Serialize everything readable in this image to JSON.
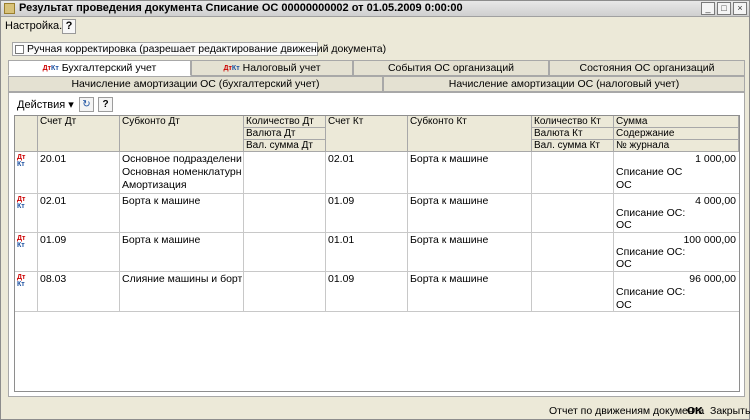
{
  "window": {
    "title": "Результат проведения документа Списание ОС 00000000002 от 01.05.2009 0:00:00",
    "min": "_",
    "max": "□",
    "close": "×"
  },
  "menu": {
    "settings": "Настройка...",
    "help": "?"
  },
  "manual": {
    "label": "Ручная корректировка (разрешает редактирование движений документа)"
  },
  "tabs": {
    "row1": [
      "Бухгалтерский учет",
      "Налоговый учет",
      "События ОС организаций",
      "Состояния ОС организаций"
    ],
    "row2": [
      "Начисление амортизации ОС (бухгалтерский учет)",
      "Начисление амортизации ОС (налоговый учет)"
    ]
  },
  "toolbar": {
    "actions": "Действия",
    "refresh": "↻",
    "help": "?"
  },
  "headers": {
    "schet_dt": "Счет Дт",
    "subkonto_dt": "Субконто Дт",
    "kol_dt": "Количество Дт",
    "val_dt": "Валюта Дт",
    "valsum_dt": "Вал. сумма Дт",
    "schet_kt": "Счет Кт",
    "subkonto_kt": "Субконто Кт",
    "kol_kt": "Количество Кт",
    "val_kt": "Валюта Кт",
    "valsum_kt": "Вал. сумма Кт",
    "summa": "Сумма",
    "soderzhanie": "Содержание",
    "journal": "№ журнала"
  },
  "rows": [
    {
      "dt": "20.01",
      "sub1": "Основное подразделение",
      "sub2": "Основная номенклатурная г...",
      "sub3": "Амортизация",
      "kt": "02.01",
      "subkt": "Борта к машине",
      "summa": "1 000,00",
      "content": "Списание ОС",
      "journal": "ОС"
    },
    {
      "dt": "02.01",
      "sub1": "Борта к машине",
      "sub2": "",
      "sub3": "",
      "kt": "01.09",
      "subkt": "Борта к машине",
      "summa": "4 000,00",
      "content": "Списание ОС:",
      "journal": "ОС"
    },
    {
      "dt": "01.09",
      "sub1": "Борта к машине",
      "sub2": "",
      "sub3": "",
      "kt": "01.01",
      "subkt": "Борта к машине",
      "summa": "100 000,00",
      "content": "Списание ОС:",
      "journal": "ОС"
    },
    {
      "dt": "08.03",
      "sub1": "Слияние машины и бортов к...",
      "sub2": "",
      "sub3": "",
      "kt": "01.09",
      "subkt": "Борта к машине",
      "summa": "96 000,00",
      "content": "Списание ОС:",
      "journal": "ОС"
    }
  ],
  "row_icon": {
    "top": "Дт",
    "bottom": "Кт"
  },
  "status": {
    "report": "Отчет по движениям документа",
    "ok": "OK",
    "close": "Закрыть"
  }
}
